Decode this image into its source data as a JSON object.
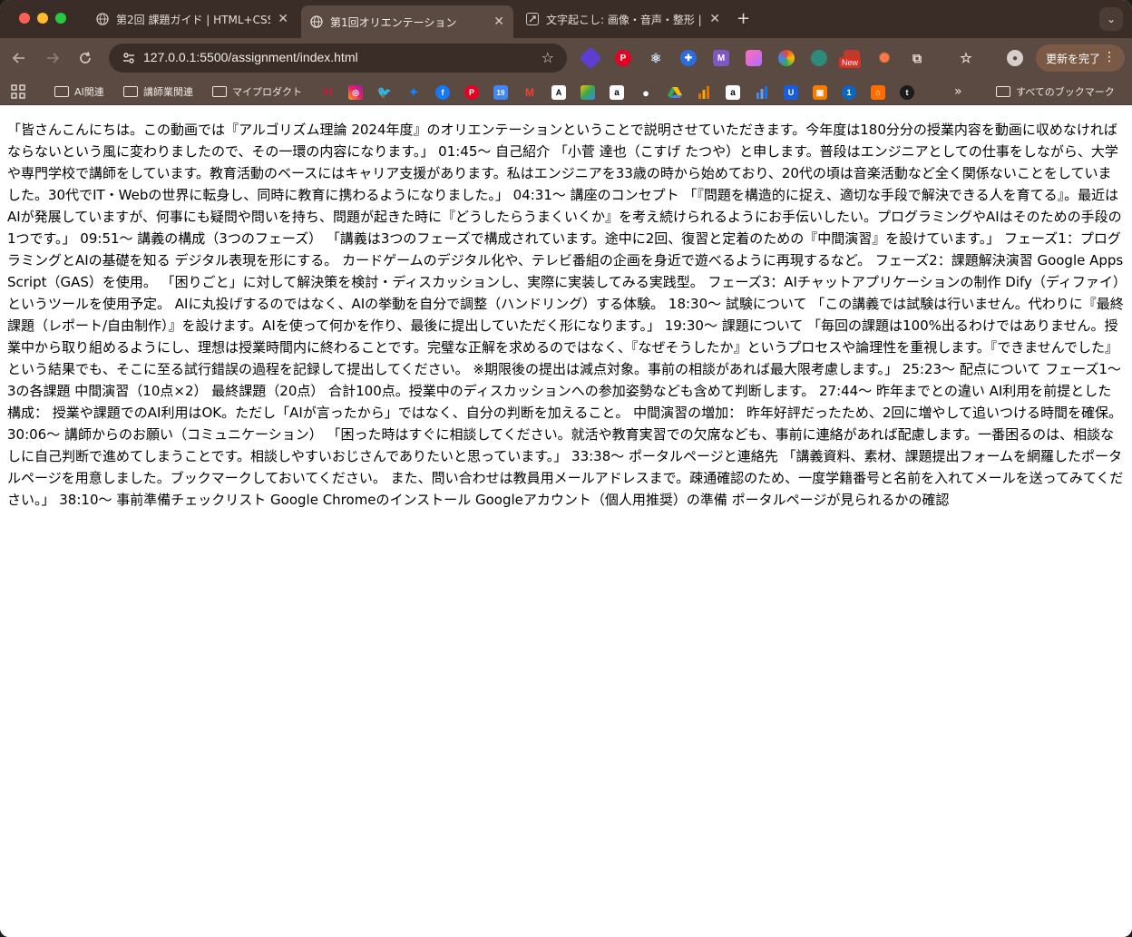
{
  "tabs": [
    {
      "title": "第2回 課題ガイド | HTML+CSS",
      "favicon": "globe-icon"
    },
    {
      "title": "第1回オリエンテーション",
      "favicon": "globe-icon"
    },
    {
      "title": "文字起こし: 画像・音声・整形 | C",
      "favicon": "app-icon"
    }
  ],
  "toolbar": {
    "url": "127.0.0.1:5500/assignment/index.html",
    "update_label": "更新を完了",
    "new_badge": "New"
  },
  "bookmarks": {
    "items": [
      "AI関連",
      "講師業関連",
      "マイプロダクト"
    ],
    "all_label": "すべてのブックマーク"
  },
  "colors": {
    "tab_strip": "#3a2d27",
    "toolbar": "#5a4a42",
    "update_button": "#7a5a45"
  },
  "page": {
    "body": "「皆さんこんにちは。この動画では『アルゴリズム理論 2024年度』のオリエンテーションということで説明させていただきます。今年度は180分分の授業内容を動画に収めなければならないという風に変わりましたので、その一環の内容になります。」 01:45〜 自己紹介 「小菅 達也（こすげ たつや）と申します。普段はエンジニアとしての仕事をしながら、大学や専門学校で講師をしています。教育活動のベースにはキャリア支援があります。私はエンジニアを33歳の時から始めており、20代の頃は音楽活動など全く関係ないことをしていました。30代でIT・Webの世界に転身し、同時に教育に携わるようになりました。」 04:31〜 講座のコンセプト 「『問題を構造的に捉え、適切な手段で解決できる人を育てる』。最近はAIが発展していますが、何事にも疑問や問いを持ち、問題が起きた時に『どうしたらうまくいくか』を考え続けられるようにお手伝いしたい。プログラミングやAIはそのための手段の1つです。」 09:51〜 講義の構成（3つのフェーズ） 「講義は3つのフェーズで構成されています。途中に2回、復習と定着のための『中間演習』を設けています。」 フェーズ1：プログラミングとAIの基礎を知る デジタル表現を形にする。 カードゲームのデジタル化や、テレビ番組の企画を身近で遊べるように再現するなど。 フェーズ2：課題解決演習 Google Apps Script（GAS）を使用。 「困りごと」に対して解決策を検討・ディスカッションし、実際に実装してみる実践型。 フェーズ3：AIチャットアプリケーションの制作 Dify（ディファイ）というツールを使用予定。 AIに丸投げするのではなく、AIの挙動を自分で調整（ハンドリング）する体験。 18:30〜 試験について 「この講義では試験は行いません。代わりに『最終課題（レポート/自由制作）』を設けます。AIを使って何かを作り、最後に提出していただく形になります。」 19:30〜 課題について 「毎回の課題は100%出るわけではありません。授業中から取り組めるようにし、理想は授業時間内に終わることです。完璧な正解を求めるのではなく、『なぜそうしたか』というプロセスや論理性を重視します。『できませんでした』という結果でも、そこに至る試行錯誤の過程を記録して提出してください。 ※期限後の提出は減点対象。事前の相談があれば最大限考慮します。」 25:23〜 配点について フェーズ1〜3の各課題 中間演習（10点×2） 最終課題（20点） 合計100点。授業中のディスカッションへの参加姿勢なども含めて判断します。 27:44〜 昨年までとの違い AI利用を前提とした構成： 授業や課題でのAI利用はOK。ただし「AIが言ったから」ではなく、自分の判断を加えること。 中間演習の増加： 昨年好評だったため、2回に増やして追いつける時間を確保。 30:06〜 講師からのお願い（コミュニケーション） 「困った時はすぐに相談してください。就活や教育実習での欠席なども、事前に連絡があれば配慮します。一番困るのは、相談なしに自己判断で進めてしまうことです。相談しやすいおじさんでありたいと思っています。」 33:38〜 ポータルページと連絡先 「講義資料、素材、課題提出フォームを網羅したポータルページを用意しました。ブックマークしておいてください。 また、問い合わせは教員用メールアドレスまで。疎通確認のため、一度学籍番号と名前を入れてメールを送ってみてください。」 38:10〜 事前準備チェックリスト Google Chromeのインストール Googleアカウント（個人用推奨）の準備 ポータルページが見られるかの確認"
  }
}
